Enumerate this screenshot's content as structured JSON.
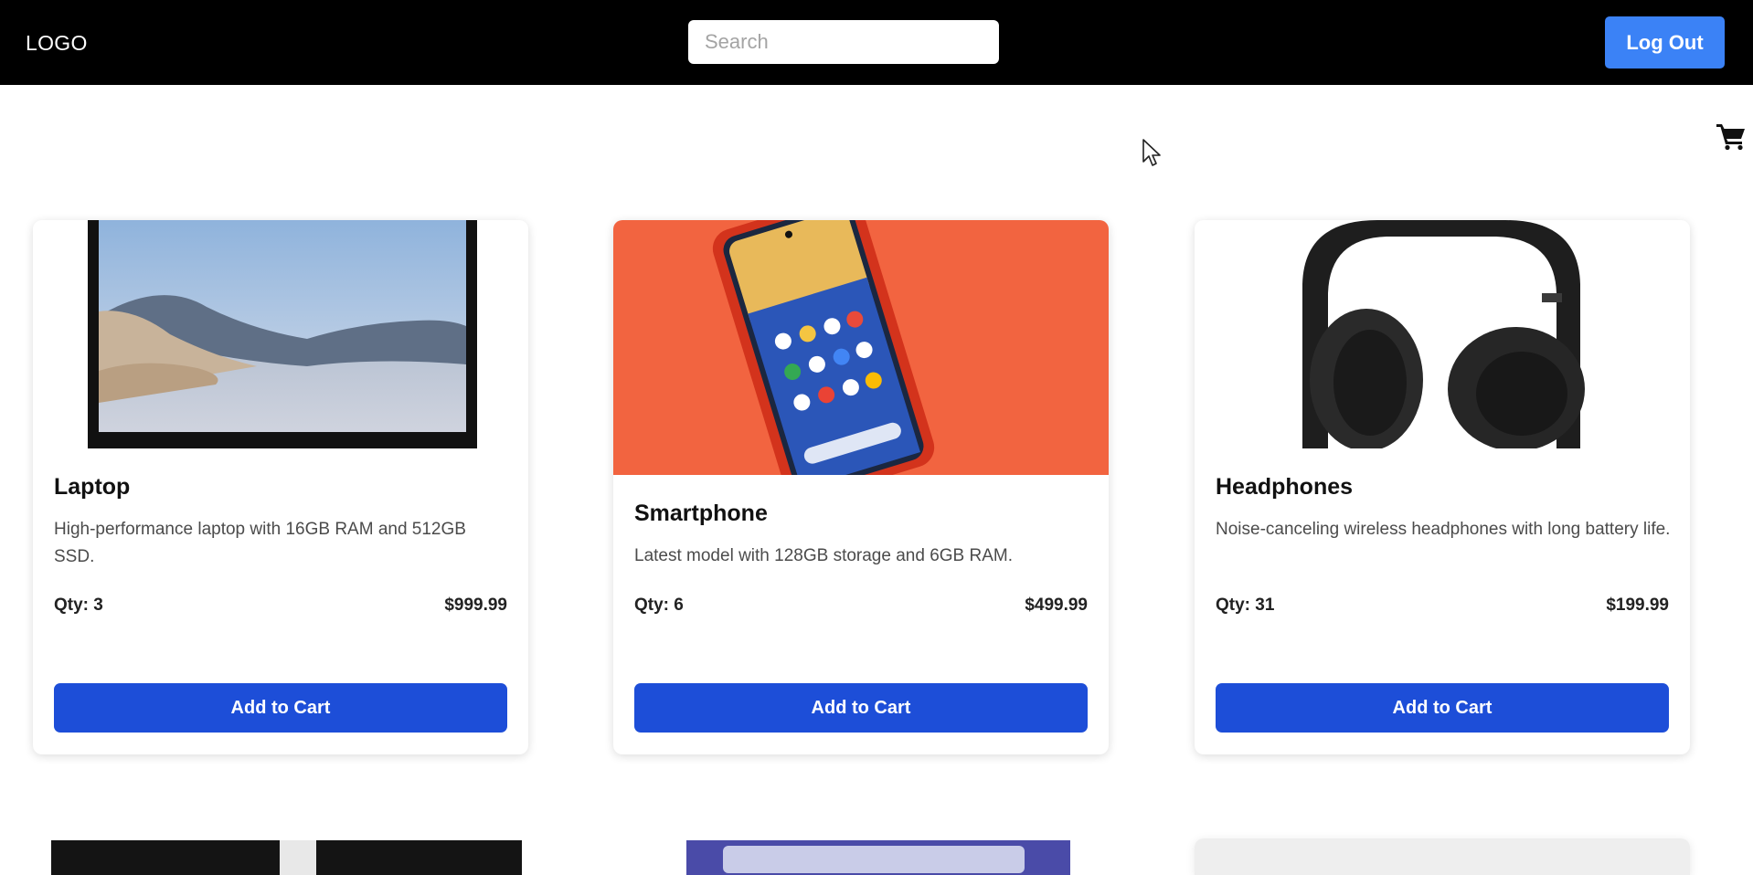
{
  "header": {
    "logo": "LOGO",
    "search_placeholder": "Search",
    "logout_label": "Log Out"
  },
  "icons": {
    "cart": "shopping-cart-icon",
    "cursor": "mouse-cursor-icon"
  },
  "colors": {
    "header_bg": "#000000",
    "logout_bg": "#3b82f6",
    "add_to_cart_bg": "#1d4ed8",
    "smartphone_image_bg": "#f26440"
  },
  "products": [
    {
      "title": "Laptop",
      "description": "High-performance laptop with 16GB RAM and 512GB SSD.",
      "qty": "Qty: 3",
      "price": "$999.99",
      "button": "Add to Cart"
    },
    {
      "title": "Smartphone",
      "description": "Latest model with 128GB storage and 6GB RAM.",
      "qty": "Qty: 6",
      "price": "$499.99",
      "button": "Add to Cart"
    },
    {
      "title": "Headphones",
      "description": "Noise-canceling wireless headphones with long battery life.",
      "qty": "Qty: 31",
      "price": "$199.99",
      "button": "Add to Cart"
    }
  ]
}
